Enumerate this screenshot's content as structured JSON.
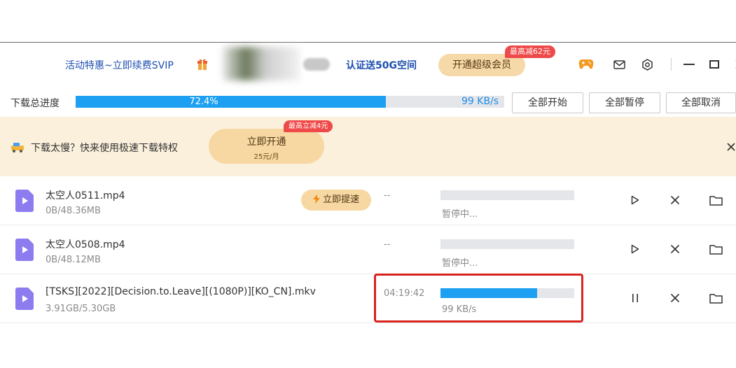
{
  "topbar": {
    "promo_left": "活动特惠~立即续费SVIP",
    "promo_right": "认证送50G空间",
    "vip_button": "开通超级会员",
    "vip_badge": "最高减62元"
  },
  "overall": {
    "label": "下载总进度",
    "percent_text": "72.4%",
    "progress": 0.724,
    "speed": "99 KB/s",
    "buttons": [
      "全部开始",
      "全部暂停",
      "全部取消"
    ]
  },
  "banner": {
    "text": "下载太慢？快来使用极速下载特权",
    "button_main": "立即开通",
    "button_sub": "25元/月",
    "badge": "最高立减4元"
  },
  "downloads": [
    {
      "name": "太空人0511.mp4",
      "size": "0B/48.36MB",
      "speedup": "立即提速",
      "remaining": "--",
      "status": "暂停中...",
      "progress": 0,
      "state": "paused"
    },
    {
      "name": "太空人0508.mp4",
      "size": "0B/48.12MB",
      "remaining": "--",
      "status": "暂停中...",
      "progress": 0,
      "state": "paused"
    },
    {
      "name": "[TSKS][2022][Decision.to.Leave][(1080P)][KO_CN].mkv",
      "size": "3.91GB/5.30GB",
      "remaining": "04:19:42",
      "status": "99 KB/s",
      "progress": 0.72,
      "state": "downloading"
    }
  ],
  "colors": {
    "accent": "#1d9ff2",
    "link": "#1e4fb0",
    "badge": "#ef4a4a",
    "gold": "#f7d8a2",
    "banner_bg": "#fbf0dc",
    "highlight": "#d9231f",
    "file_icon": "#8c7cf0"
  }
}
